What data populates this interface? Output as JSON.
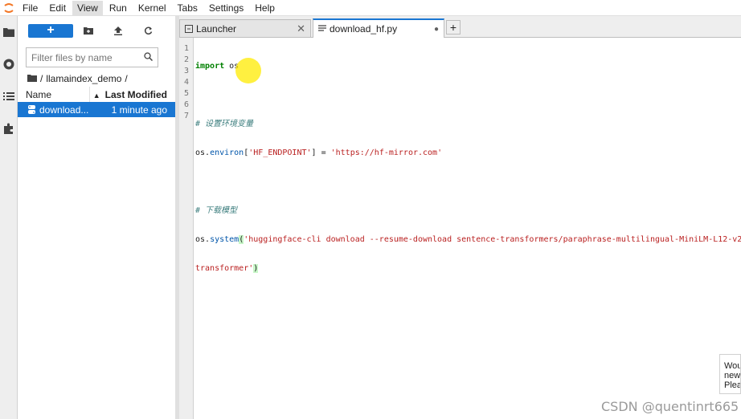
{
  "menubar": {
    "logo_icon": "jupyter-logo-icon",
    "items": [
      "File",
      "Edit",
      "View",
      "Run",
      "Kernel",
      "Tabs",
      "Settings",
      "Help"
    ],
    "active_item": "View"
  },
  "activity_bar": {
    "icons": [
      "folder-icon",
      "running-icon",
      "list-icon",
      "puzzle-icon"
    ]
  },
  "file_browser": {
    "new_button_label": "+",
    "toolbar_icons": [
      "new-folder-icon",
      "upload-icon",
      "refresh-icon"
    ],
    "filter_placeholder": "Filter files by name",
    "breadcrumb_root": "/",
    "breadcrumb_folder": "llamaindex_demo",
    "breadcrumb_trailing": "/",
    "columns": {
      "name": "Name",
      "last_modified": "Last Modified"
    },
    "files": [
      {
        "name": "download...",
        "modified": "1 minute ago",
        "icon": "python-file-icon",
        "selected": true
      }
    ]
  },
  "tabs": [
    {
      "label": "Launcher",
      "icon": "launcher-icon",
      "active": false,
      "close": "✕"
    },
    {
      "label": "download_hf.py",
      "icon": "file-icon",
      "active": true,
      "close": "●"
    }
  ],
  "add_tab_label": "+",
  "editor": {
    "line_numbers": [
      "1",
      "2",
      "3",
      "4",
      "5",
      "6",
      "7"
    ],
    "lines": {
      "l1_kw": "import",
      "l1_rest": " os",
      "l3": "# 设置环境变量",
      "l4_a": "os.",
      "l4_b": "environ",
      "l4_c": "[",
      "l4_d": "'HF_ENDPOINT'",
      "l4_e": "] = ",
      "l4_f": "'https://hf-mirror.com'",
      "l6": "# 下载模型",
      "l7_a": "os.",
      "l7_b": "system",
      "l7_c": "(",
      "l7_d": "'huggingface-cli download --resume-download sentence-transformers/paraphrase-multilingual-MiniLM-L12-v2 --local-d",
      "l7_wrap": "transformer'",
      "l7_end": ")"
    }
  },
  "notification": {
    "text": "Wou new Plea"
  },
  "watermark": "CSDN @quentinrt665",
  "colors": {
    "accent": "#1976d2",
    "comment": "#408080",
    "string": "#ba2121",
    "keyword": "#008000"
  }
}
